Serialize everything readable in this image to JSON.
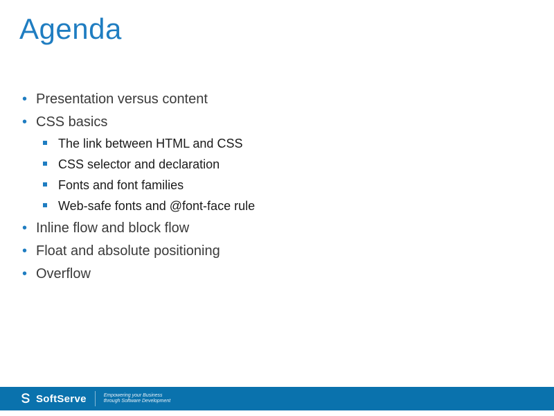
{
  "title": "Agenda",
  "bullets": {
    "b0": "Presentation versus content",
    "b1": "CSS basics",
    "b1_sub": {
      "s0": "The link between HTML and CSS",
      "s1": "CSS selector and declaration",
      "s2": "Fonts and font families",
      "s3": "Web-safe fonts and @font-face rule"
    },
    "b2": "Inline flow and block flow",
    "b3": "Float and absolute positioning",
    "b4": "Overflow"
  },
  "footer": {
    "brand": "SoftServe",
    "tagline1": "Empowering your Business",
    "tagline2": "through Software Development"
  }
}
